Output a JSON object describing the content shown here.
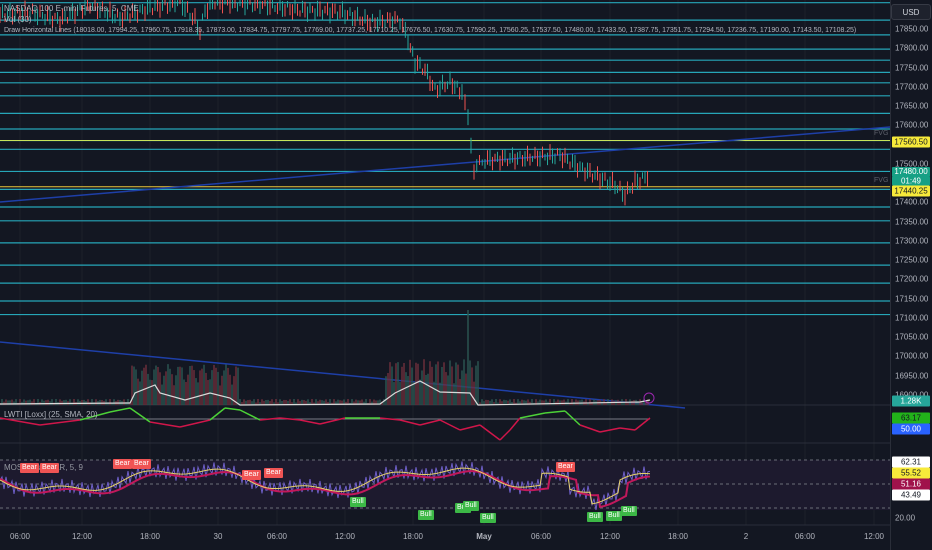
{
  "header": {
    "symbol": "NASDAQ 100 E-mini Futures, 5, CME",
    "vol": "Vol (30)",
    "hlines": "Draw Horizontal Lines (18018.00, 17994.25, 17960.75, 17918.35, 17873.00, 17834.75, 17797.75, 17769.00, 17737.25, 17710.25, 17676.50, 17630.75, 17590.25, 17560.25, 17537.50, 17480.00, 17433.50, 17387.75, 17351.75, 17294.50, 17236.75, 17190.00, 17143.50, 17108.25)",
    "lwti": "LWTI [Loxx] (25, SMA, 20)",
    "mos": "MOS Close, VAR, 5, 9"
  },
  "levels": [
    18018.0,
    17994.25,
    17960.75,
    17918.35,
    17873.0,
    17834.75,
    17797.75,
    17769.0,
    17737.25,
    17710.25,
    17676.5,
    17630.75,
    17590.25,
    17560.25,
    17537.5,
    17480.0,
    17433.5,
    17387.75,
    17351.75,
    17294.5,
    17236.75,
    17190.0,
    17143.5,
    17108.25
  ],
  "axis": {
    "currency": "USD",
    "price_ticks": [
      "17850.00",
      "17800.00",
      "17750.00",
      "17700.00",
      "17650.00",
      "17600.00",
      "17500.00",
      "17400.00",
      "17350.00",
      "17300.00",
      "17250.00",
      "17200.00",
      "17150.00",
      "17100.00",
      "17050.00",
      "17000.00",
      "16950.00",
      "16900.00"
    ],
    "osc_ticks": [
      "20.00"
    ],
    "tags": {
      "fvg_high": "17560.50",
      "last_price": "17480.00",
      "countdown": "01:49",
      "fvg_low": "17440.25",
      "volume": "1.28K",
      "lwti_up": "63.17",
      "lwti_mid": "50.00",
      "mos_1": "62.31",
      "mos_2": "55.52",
      "mos_3": "51.16",
      "mos_4": "43.49"
    },
    "time_ticks": [
      "06:00",
      "12:00",
      "18:00",
      "30",
      "06:00",
      "12:00",
      "18:00",
      "May",
      "06:00",
      "12:00",
      "18:00",
      "2",
      "06:00",
      "12:00"
    ]
  },
  "fvg_label": "FVG",
  "signals": {
    "bear": "Bear",
    "bull": "Bull"
  },
  "colors": {
    "bg": "#131722",
    "level": "#26a6b8",
    "trend": "#1e3fa8",
    "fvg": "#e9e24a",
    "up": "#26a69a",
    "down": "#ef5350",
    "green": "#4caf50",
    "red": "#d0164a"
  }
}
